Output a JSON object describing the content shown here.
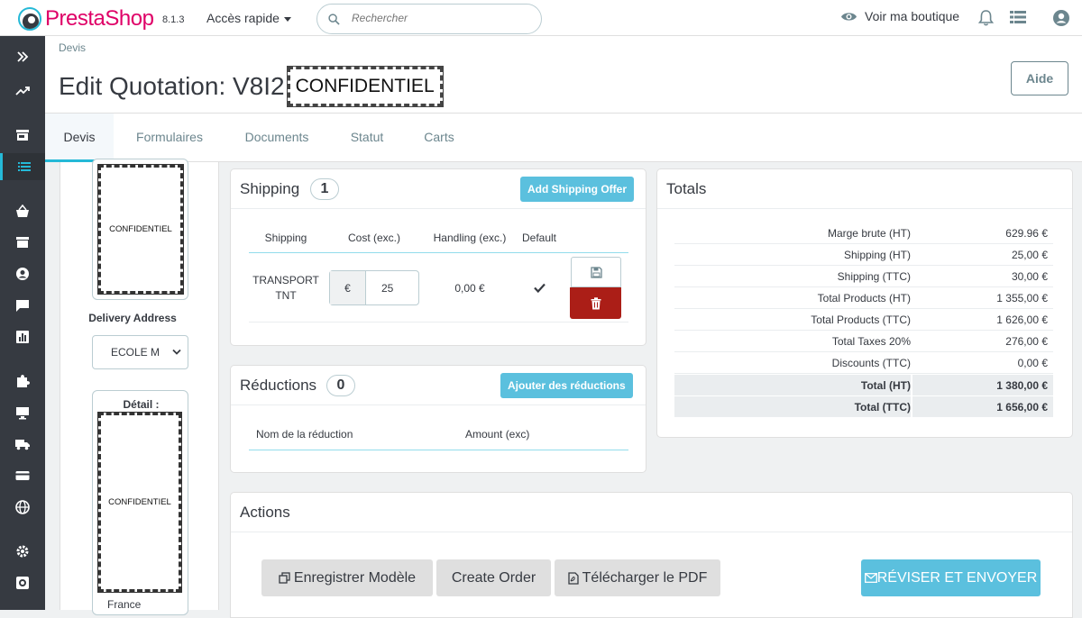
{
  "topbar": {
    "logo_text": "PrestaShop",
    "version": "8.1.3",
    "quick_access": "Accès rapide",
    "search_placeholder": "Rechercher",
    "view_shop": "Voir ma boutique"
  },
  "header": {
    "breadcrumb": "Devis",
    "title": "Edit Quotation: V8I2",
    "confidential": "CONFIDENTIEL",
    "help": "Aide"
  },
  "tabs": [
    "Devis",
    "Formulaires",
    "Documents",
    "Statut",
    "Carts"
  ],
  "left": {
    "card_top_text": "CONFIDENTIEL",
    "delivery_label": "Delivery Address",
    "delivery_value": "ECOLE M",
    "detail_label": "Détail :",
    "detail_text": "CONFIDENTIEL",
    "country": "France"
  },
  "shipping": {
    "title": "Shipping",
    "count": "1",
    "add_button": "Add Shipping Offer",
    "headers": [
      "Shipping",
      "Cost (exc.)",
      "Handling (exc.)",
      "Default"
    ],
    "row": {
      "name_line1": "TRANSPORT",
      "name_line2": "TNT",
      "currency": "€",
      "cost": "25",
      "handling": "0,00 €",
      "default_icon": "check-icon"
    }
  },
  "reductions": {
    "title": "Réductions",
    "count": "0",
    "add_button": "Ajouter des réductions",
    "headers": [
      "Nom de la réduction",
      "Amount (exc)"
    ]
  },
  "totals": {
    "title": "Totals",
    "rows": [
      {
        "label": "Marge brute (HT)",
        "value": "629.96 €"
      },
      {
        "label": "Shipping (HT)",
        "value": "25,00 €"
      },
      {
        "label": "Shipping (TTC)",
        "value": "30,00 €"
      },
      {
        "label": "Total Products (HT)",
        "value": "1 355,00 €"
      },
      {
        "label": "Total Products (TTC)",
        "value": "1 626,00 €"
      },
      {
        "label": "Total Taxes 20%",
        "value": "276,00 €"
      },
      {
        "label": "Discounts (TTC)",
        "value": "0,00 €"
      },
      {
        "label": "Total (HT)",
        "value": "1 380,00 €"
      },
      {
        "label": "Total (TTC)",
        "value": "1 656,00 €"
      }
    ]
  },
  "actions": {
    "title": "Actions",
    "save_model": "Enregistrer Modèle",
    "create_order": "Create Order",
    "download_pdf": "Télécharger le PDF",
    "review_send": "RÉVISER ET ENVOYER"
  },
  "colors": {
    "brand": "#df0067",
    "accent": "#25b9d7",
    "info": "#5bc0de",
    "danger": "#ab1e17",
    "sidebar": "#363a41"
  }
}
